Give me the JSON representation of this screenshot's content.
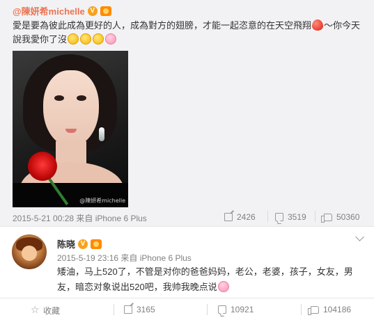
{
  "repost": {
    "author": "@陳妍希michelle",
    "text_part1": "愛是要為彼此成為更好的人，成為對方的翅膀，才能一起恣意的在天空飛翔",
    "text_part2": "～你今天說我愛你了沒",
    "photo_watermark": "@陳妍希michelle",
    "timestamp": "2015-5-21 00:28",
    "source": "来自 iPhone 6 Plus",
    "shares": "2426",
    "comments": "3519",
    "likes": "50360"
  },
  "post": {
    "author": "陈晓",
    "timestamp": "2015-5-19 23:16",
    "source": "来自 iPhone 6 Plus",
    "text": "矮油，马上520了，不管是对你的爸爸妈妈，老公，老婆，孩子，女友，男友，暗恋对象说出520吧，我帅我晚点说"
  },
  "actions": {
    "favorite_label": "收藏",
    "shares": "3165",
    "comments": "10921",
    "likes": "104186"
  },
  "icons": {
    "verified": "verified-badge-icon",
    "vip": "vip-badge-icon",
    "menu": "chevron-down-icon"
  },
  "colors": {
    "author_link": "#eb7350",
    "meta_gray": "#808080",
    "repost_bg": "#f2f2f5"
  }
}
